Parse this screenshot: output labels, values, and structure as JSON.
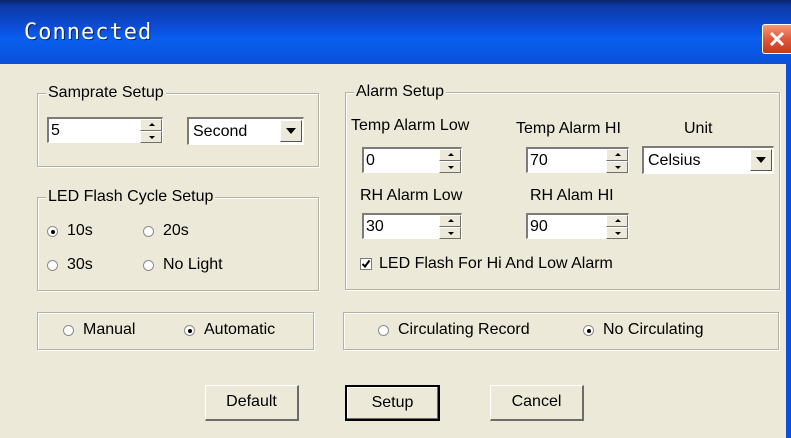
{
  "window": {
    "title": "Connected"
  },
  "samprate": {
    "group_title": "Samprate Setup",
    "value": "5",
    "unit_selected": "Second"
  },
  "led_cycle": {
    "group_title": "LED Flash Cycle Setup",
    "options": [
      {
        "label": "10s",
        "selected": true
      },
      {
        "label": "20s",
        "selected": false
      },
      {
        "label": "30s",
        "selected": false
      },
      {
        "label": "No Light",
        "selected": false
      }
    ]
  },
  "alarm": {
    "group_title": "Alarm Setup",
    "temp_low_label": "Temp Alarm Low",
    "temp_low_value": "0",
    "temp_hi_label": "Temp Alarm HI",
    "temp_hi_value": "70",
    "unit_label": "Unit",
    "unit_selected": "Celsius",
    "rh_low_label": "RH Alarm Low",
    "rh_low_value": "30",
    "rh_hi_label": "RH Alam HI",
    "rh_hi_value": "90",
    "led_flash_checkbox_label": "LED Flash For Hi And Low  Alarm",
    "led_flash_checked": true
  },
  "mode": {
    "manual_label": "Manual",
    "automatic_label": "Automatic",
    "selected": "Automatic"
  },
  "record": {
    "circulating_label": "Circulating Record",
    "no_circulating_label": "No Circulating",
    "selected": "No Circulating"
  },
  "buttons": {
    "default_label": "Default",
    "setup_label": "Setup",
    "cancel_label": "Cancel"
  },
  "colors": {
    "titlebar": "#0b50d8",
    "dialog_bg": "#ece9d8",
    "close_button": "#e2583a"
  }
}
